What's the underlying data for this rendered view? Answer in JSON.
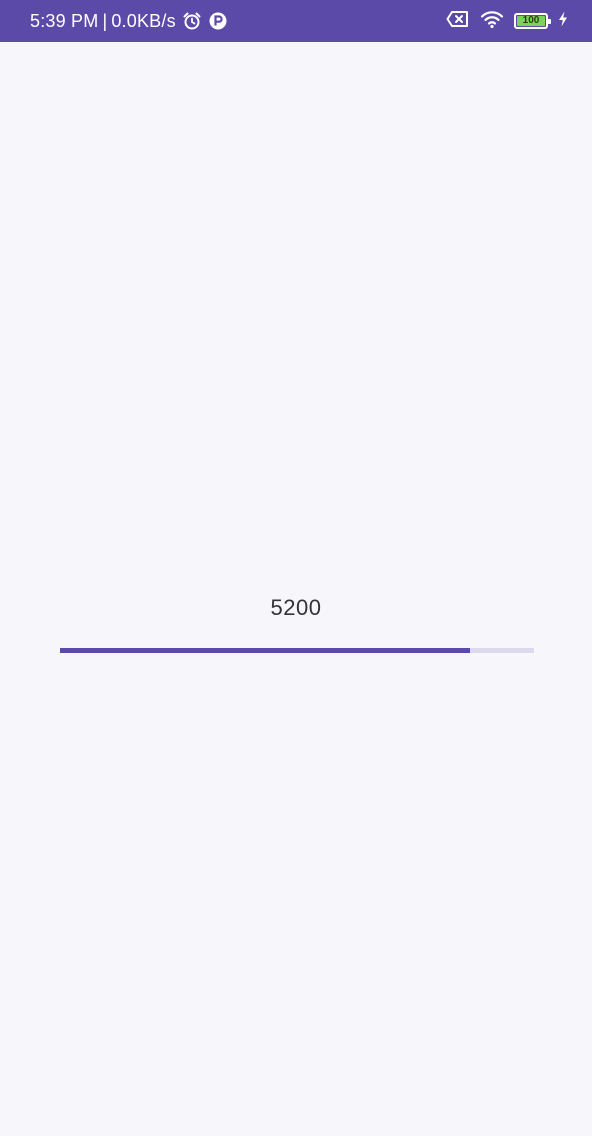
{
  "status_bar": {
    "time": "5:39 PM",
    "separator": "|",
    "network_speed": "0.0KB/s",
    "battery_level": "100",
    "icons": [
      "alarm-icon",
      "app-notification-icon",
      "no-sim-icon",
      "wifi-icon",
      "battery-icon",
      "charging-icon"
    ],
    "background_color": "#5c4aa8"
  },
  "main": {
    "progress_value": "5200",
    "progress_fraction": 0.865,
    "accent_color": "#5c4aa8",
    "track_color": "#dcd8ee"
  }
}
